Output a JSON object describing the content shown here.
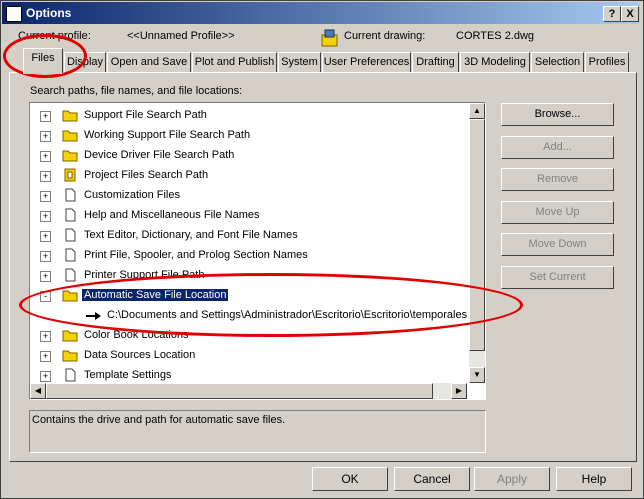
{
  "window": {
    "title": "Options",
    "help_btn": "?",
    "close_btn": "X"
  },
  "profile": {
    "current_profile_label": "Current profile:",
    "current_profile_value": "<<Unnamed Profile>>",
    "current_drawing_label": "Current drawing:",
    "current_drawing_value": "CORTES 2.dwg"
  },
  "tabs": [
    "Files",
    "Display",
    "Open and Save",
    "Plot and Publish",
    "System",
    "User Preferences",
    "Drafting",
    "3D Modeling",
    "Selection",
    "Profiles"
  ],
  "active_tab": "Files",
  "tree": {
    "header": "Search paths, file names, and file locations:",
    "items": [
      {
        "label": "Support File Search Path",
        "icon": "folder-icon",
        "expander": "+"
      },
      {
        "label": "Working Support File Search Path",
        "icon": "folder-icon",
        "expander": "+"
      },
      {
        "label": "Device Driver File Search Path",
        "icon": "folder-icon",
        "expander": "+"
      },
      {
        "label": "Project Files Search Path",
        "icon": "project-icon",
        "expander": "+"
      },
      {
        "label": "Customization Files",
        "icon": "file-icon",
        "expander": "+"
      },
      {
        "label": "Help and Miscellaneous File Names",
        "icon": "file-icon",
        "expander": "+"
      },
      {
        "label": "Text Editor, Dictionary, and Font File Names",
        "icon": "file-icon",
        "expander": "+"
      },
      {
        "label": "Print File, Spooler, and Prolog Section Names",
        "icon": "file-icon",
        "expander": "+"
      },
      {
        "label": "Printer Support File Path",
        "icon": "file-icon",
        "expander": "+"
      },
      {
        "label": "Automatic Save File Location",
        "icon": "folder-icon",
        "expander": "-",
        "selected": true
      },
      {
        "label": "C:\\Documents and Settings\\Administrador\\Escritorio\\Escritorio\\temporales de",
        "icon": "arrow-icon",
        "child": true
      },
      {
        "label": "Color Book Locations",
        "icon": "folder-icon",
        "expander": "+"
      },
      {
        "label": "Data Sources Location",
        "icon": "folder-icon",
        "expander": "+"
      },
      {
        "label": "Template Settings",
        "icon": "file-icon",
        "expander": "+"
      }
    ]
  },
  "side_buttons": [
    {
      "label": "Browse...",
      "enabled": true
    },
    {
      "label": "Add...",
      "enabled": false
    },
    {
      "label": "Remove",
      "enabled": false
    },
    {
      "label": "Move Up",
      "enabled": false
    },
    {
      "label": "Move Down",
      "enabled": false
    },
    {
      "label": "Set Current",
      "enabled": false
    }
  ],
  "description": "Contains the drive and path for automatic save files.",
  "bottom_buttons": [
    {
      "label": "OK",
      "enabled": true
    },
    {
      "label": "Cancel",
      "enabled": true
    },
    {
      "label": "Apply",
      "enabled": false
    },
    {
      "label": "Help",
      "enabled": true
    }
  ],
  "colors": {
    "title_start": "#0a246a",
    "title_end": "#a6caf0",
    "selection": "#0a246a",
    "annotation": "#e00000",
    "folder": "#f4d000"
  }
}
